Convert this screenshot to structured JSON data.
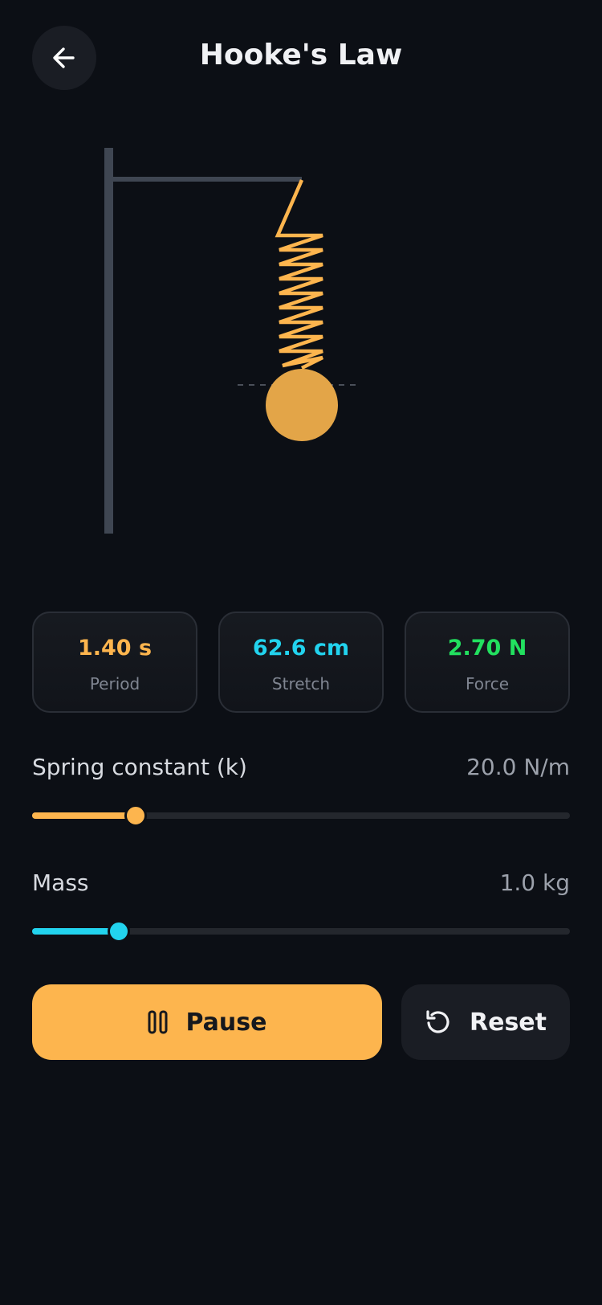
{
  "header": {
    "title": "Hooke's Law",
    "back_icon": "arrow-left-icon"
  },
  "stats": [
    {
      "value": "1.40 s",
      "label": "Period",
      "color": "#fdb54e"
    },
    {
      "value": "62.6 cm",
      "label": "Stretch",
      "color": "#22d3ee"
    },
    {
      "value": "2.70 N",
      "label": "Force",
      "color": "#22e05f"
    }
  ],
  "controls": {
    "spring": {
      "label": "Spring constant (k)",
      "value": "20.0 N/m",
      "fraction": 0.193,
      "color": "#fdb54e"
    },
    "mass": {
      "label": "Mass",
      "value": "1.0 kg",
      "fraction": 0.161,
      "color": "#22d3ee"
    }
  },
  "buttons": {
    "pause_label": "Pause",
    "pause_icon": "pause-icon",
    "reset_label": "Reset",
    "reset_icon": "reset-icon"
  },
  "colors": {
    "accent": "#fdb54e",
    "background": "#0c0f15",
    "stand": "#3f4652"
  }
}
